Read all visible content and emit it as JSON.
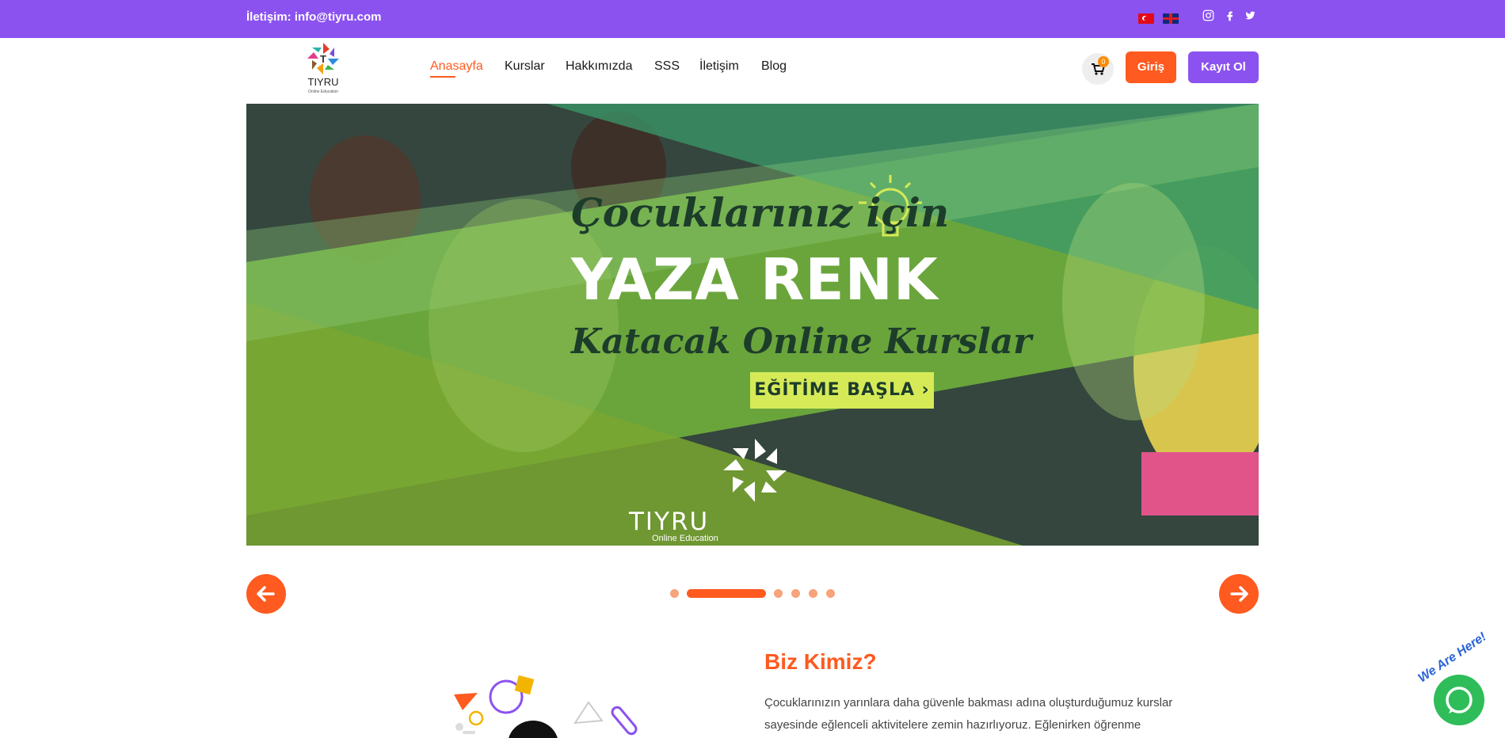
{
  "topbar": {
    "contact": "İletişim: info@tiyru.com",
    "languages": [
      "tr",
      "en"
    ],
    "social": [
      "instagram-icon",
      "facebook-icon",
      "twitter-icon"
    ]
  },
  "header": {
    "logo_text": "TIYRU",
    "logo_sub": "Online Education",
    "nav": [
      "Anasayfa",
      "Kurslar",
      "Hakkımızda",
      "SSS",
      "İletişim",
      "Blog"
    ],
    "active_nav": "Anasayfa",
    "cart_count": "0",
    "login_label": "Giriş",
    "register_label": "Kayıt Ol"
  },
  "hero": {
    "line1": "Çocuklarınız için",
    "line2": "YAZA RENK",
    "line3": "Katacak Online Kurslar",
    "cta": "EĞİTİME BAŞLA",
    "brand": "TIYRU",
    "brand_sub": "Online Education"
  },
  "slider": {
    "total": 6,
    "active_index": 1
  },
  "about": {
    "title": "Biz Kimiz?",
    "text": "Çocuklarınızın yarınlara daha güvenle bakması adına oluşturduğumuz kurslar sayesinde eğlenceli aktivitelere zemin hazırlıyoruz. Eğlenirken öğrenme"
  },
  "chat": {
    "label": "We Are Here!"
  },
  "colors": {
    "brand_purple": "#8b52f0",
    "accent_orange": "#ff5a1f",
    "hero_green": "#6fa83a",
    "cta_yellow": "#d6ea57"
  }
}
